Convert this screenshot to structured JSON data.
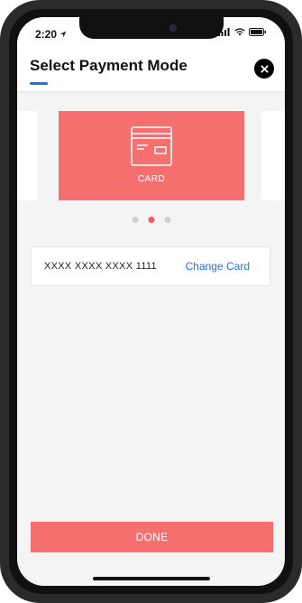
{
  "status_bar": {
    "time": "2:20",
    "icons": [
      "location-arrow-icon",
      "signal-icon",
      "wifi-icon",
      "battery-icon"
    ]
  },
  "header": {
    "title": "Select Payment Mode",
    "close_icon": "close-icon",
    "accent": "#1a73e8"
  },
  "carousel": {
    "active_index": 1,
    "total": 3,
    "card": {
      "label": "CARD",
      "icon": "credit-cards-icon",
      "color": "#f56f6f"
    }
  },
  "selected_card": {
    "number": "XXXX XXXX XXXX 1111",
    "change_label": "Change Card"
  },
  "footer": {
    "done_label": "DONE",
    "color": "#f56f6f"
  }
}
